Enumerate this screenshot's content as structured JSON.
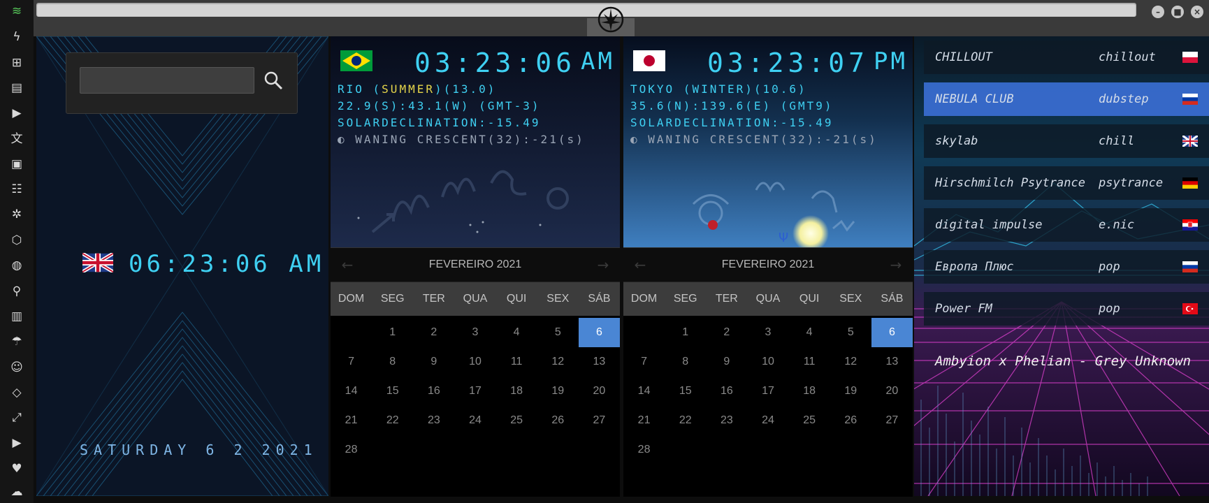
{
  "colors": {
    "accent_cyan": "#3fd0f2",
    "highlight_yellow": "#e5d54a",
    "calendar_today": "#4a86d4",
    "radio_active": "#3a6ed2"
  },
  "sidebar": {
    "items": [
      {
        "icon": "wifi-icon",
        "glyph": "≋"
      },
      {
        "icon": "lightning-icon",
        "glyph": "ϟ"
      },
      {
        "icon": "windows-icon",
        "glyph": "⊞"
      },
      {
        "icon": "archive-icon",
        "glyph": "▤"
      },
      {
        "icon": "play-icon",
        "glyph": "▶"
      },
      {
        "icon": "translate-icon",
        "glyph": "文"
      },
      {
        "icon": "image-icon",
        "glyph": "▣"
      },
      {
        "icon": "news-icon",
        "glyph": "☷"
      },
      {
        "icon": "settings-icon",
        "glyph": "✲"
      },
      {
        "icon": "hexagon-icon",
        "glyph": "⬡"
      },
      {
        "icon": "globe-icon",
        "glyph": "◍"
      },
      {
        "icon": "search-icon",
        "glyph": "⚲"
      },
      {
        "icon": "map-icon",
        "glyph": "▥"
      },
      {
        "icon": "umbrella-icon",
        "glyph": "☂"
      },
      {
        "icon": "contacts-icon",
        "glyph": "☺"
      },
      {
        "icon": "code-icon",
        "glyph": "◇"
      },
      {
        "icon": "fullscreen-icon",
        "glyph": "⤢"
      },
      {
        "icon": "youtube-icon",
        "glyph": "▶"
      },
      {
        "icon": "heart-icon",
        "glyph": "♥"
      },
      {
        "icon": "cloud-icon",
        "glyph": "☁"
      }
    ]
  },
  "window_controls": {
    "minimize": "–",
    "maximize": "■",
    "close": "×"
  },
  "home": {
    "search_value": "",
    "time": "06:23:06 AM",
    "date": "SATURDAY 6 2 2021"
  },
  "clocks": [
    {
      "time": "03:23:06",
      "ampm": "AM",
      "line1_prefix": "RIO (",
      "season": "SUMMER",
      "line1_suffix": ")(13.0)",
      "line2": "22.9(S):43.1(W) (GMT-3)",
      "line3": "SOLARDECLINATION:-15.49",
      "moon": "WANING CRESCENT(32):-21(s)"
    },
    {
      "time": "03:23:07",
      "ampm": "PM",
      "line1_prefix": "TOKYO (",
      "season": "WINTER",
      "line1_suffix": ")(10.6)",
      "line2": "35.6(N):139.6(E) (GMT9)",
      "line3": "SOLARDECLINATION:-15.49",
      "moon": "WANING CRESCENT(32):-21(s)"
    }
  ],
  "calendar": {
    "title": "FEVEREIRO 2021",
    "prev": "←",
    "next": "→",
    "weekdays": [
      "DOM",
      "SEG",
      "TER",
      "QUA",
      "QUI",
      "SEX",
      "SÁB"
    ],
    "first_weekday_offset": 1,
    "days_in_month": 28,
    "today": 6
  },
  "radio": {
    "stations": [
      {
        "name": "CHILLOUT",
        "genre": "chillout",
        "flag": "poland"
      },
      {
        "name": "NEBULA CLUB",
        "genre": "dubstep",
        "flag": "russia"
      },
      {
        "name": "skylab",
        "genre": "chill",
        "flag": "uk"
      },
      {
        "name": "Hirschmilch Psytrance",
        "genre": "psytrance",
        "flag": "germany"
      },
      {
        "name": "digital impulse",
        "genre": "e.nic",
        "flag": "croatia"
      },
      {
        "name": "Европа Плюс",
        "genre": "pop",
        "flag": "russia"
      },
      {
        "name": "Power FM",
        "genre": "pop",
        "flag": "turkey"
      }
    ],
    "active_index": 1,
    "now_playing": "Ambyion x Phelian - Grey Unknown"
  }
}
